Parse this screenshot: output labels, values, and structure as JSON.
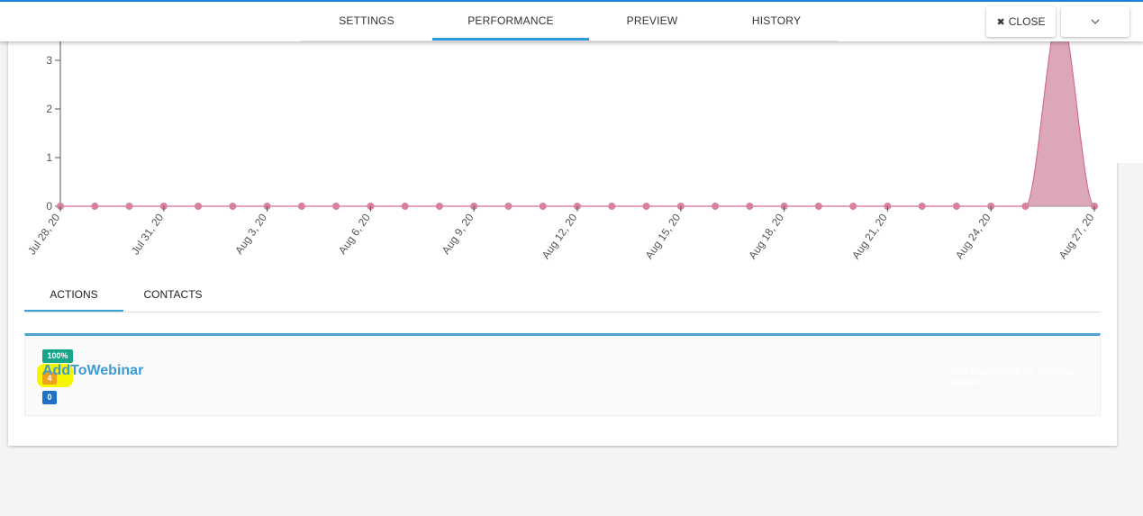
{
  "header": {
    "tabs": [
      {
        "label": "SETTINGS",
        "active": false
      },
      {
        "label": "PERFORMANCE",
        "active": true
      },
      {
        "label": "PREVIEW",
        "active": false
      },
      {
        "label": "HISTORY",
        "active": false
      }
    ],
    "close_label": "CLOSE",
    "close_icon": "x-icon",
    "dropdown_icon": "chevron-down-icon",
    "accent_color": "#2d9bdb"
  },
  "chart_data": {
    "type": "area",
    "x": [
      "Jul 28",
      "Jul 29",
      "Jul 30",
      "Jul 31",
      "Aug 1",
      "Aug 2",
      "Aug 3",
      "Aug 4",
      "Aug 5",
      "Aug 6",
      "Aug 7",
      "Aug 8",
      "Aug 9",
      "Aug 10",
      "Aug 11",
      "Aug 12",
      "Aug 13",
      "Aug 14",
      "Aug 15",
      "Aug 16",
      "Aug 17",
      "Aug 18",
      "Aug 19",
      "Aug 20",
      "Aug 21",
      "Aug 22",
      "Aug 23",
      "Aug 24",
      "Aug 25",
      "Aug 26",
      "Aug 27"
    ],
    "values": [
      0,
      0,
      0,
      0,
      0,
      0,
      0,
      0,
      0,
      0,
      0,
      0,
      0,
      0,
      0,
      0,
      0,
      0,
      0,
      0,
      0,
      0,
      0,
      0,
      0,
      0,
      0,
      0,
      0,
      4,
      0
    ],
    "x_tick_labels": [
      "Jul 28, 20",
      "Jul 31, 20",
      "Aug 3, 20",
      "Aug 6, 20",
      "Aug 9, 20",
      "Aug 12, 20",
      "Aug 15, 20",
      "Aug 18, 20",
      "Aug 21, 20",
      "Aug 24, 20",
      "Aug 27, 20"
    ],
    "y_ticks": [
      "0",
      "1",
      "2",
      "3"
    ],
    "color": "#d08aa1",
    "grid": false
  },
  "subtabs": [
    {
      "label": "ACTIONS",
      "active": true
    },
    {
      "label": "CONTACTS",
      "active": false
    }
  ],
  "action": {
    "name": "AddToWebinar",
    "percent_badge": "100%",
    "count_badge_orange": "4",
    "count_badge_blue": "0",
    "description": "Add Registrant To Webinar Action"
  }
}
